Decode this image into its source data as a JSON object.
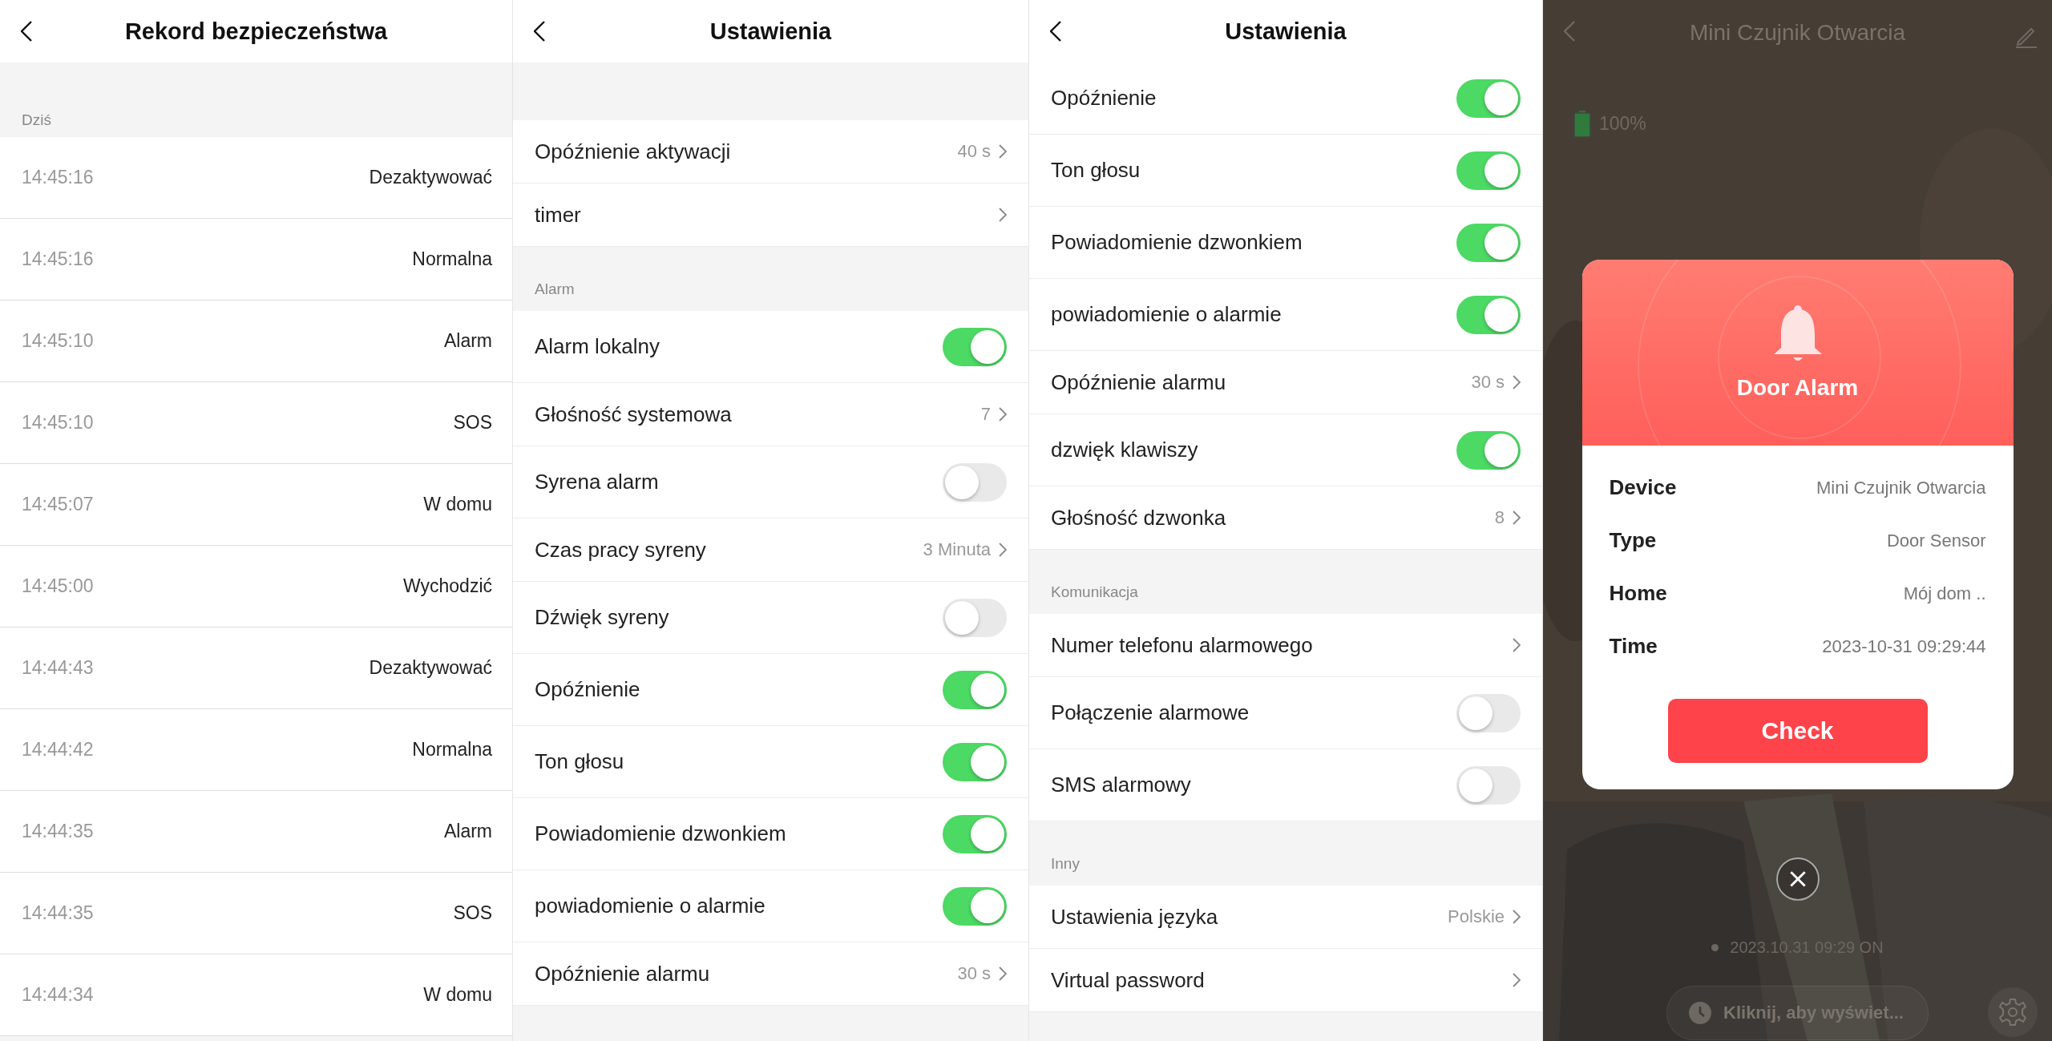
{
  "screens": [
    {
      "kind": "history",
      "title": "Rekord bezpieczeństwa",
      "section": "Dziś",
      "records": [
        {
          "time": "14:45:16",
          "event": "Dezaktywować"
        },
        {
          "time": "14:45:16",
          "event": "Normalna"
        },
        {
          "time": "14:45:10",
          "event": "Alarm"
        },
        {
          "time": "14:45:10",
          "event": "SOS"
        },
        {
          "time": "14:45:07",
          "event": "W domu"
        },
        {
          "time": "14:45:00",
          "event": "Wychodzić"
        },
        {
          "time": "14:44:43",
          "event": "Dezaktywować"
        },
        {
          "time": "14:44:42",
          "event": "Normalna"
        },
        {
          "time": "14:44:35",
          "event": "Alarm"
        },
        {
          "time": "14:44:35",
          "event": "SOS"
        },
        {
          "time": "14:44:34",
          "event": "W domu"
        }
      ]
    },
    {
      "kind": "settings",
      "title": "Ustawienia",
      "rows": [
        {
          "kind": "nav",
          "label": "Opóźnienie aktywacji",
          "value": "40 s"
        },
        {
          "kind": "nav",
          "label": "timer"
        },
        {
          "kind": "section",
          "label": "Alarm"
        },
        {
          "kind": "toggle",
          "label": "Alarm lokalny",
          "on": true
        },
        {
          "kind": "nav",
          "label": "Głośność systemowa",
          "value": "7"
        },
        {
          "kind": "toggle",
          "label": "Syrena alarm",
          "on": false
        },
        {
          "kind": "nav",
          "label": "Czas pracy syreny",
          "value": "3 Minuta"
        },
        {
          "kind": "toggle",
          "label": "Dźwięk syreny",
          "on": false
        },
        {
          "kind": "toggle",
          "label": "Opóźnienie",
          "on": true
        },
        {
          "kind": "toggle",
          "label": "Ton głosu",
          "on": true
        },
        {
          "kind": "toggle",
          "label": "Powiadomienie dzwonkiem",
          "on": true
        },
        {
          "kind": "toggle",
          "label": "powiadomienie o alarmie",
          "on": true
        },
        {
          "kind": "nav",
          "label": "Opóźnienie alarmu",
          "value": "30 s"
        }
      ]
    },
    {
      "kind": "settings",
      "title": "Ustawienia",
      "rows": [
        {
          "kind": "toggle",
          "label": "Opóźnienie",
          "on": true
        },
        {
          "kind": "toggle",
          "label": "Ton głosu",
          "on": true
        },
        {
          "kind": "toggle",
          "label": "Powiadomienie dzwonkiem",
          "on": true
        },
        {
          "kind": "toggle",
          "label": "powiadomienie o alarmie",
          "on": true
        },
        {
          "kind": "nav",
          "label": "Opóźnienie alarmu",
          "value": "30 s"
        },
        {
          "kind": "toggle",
          "label": "dzwięk klawiszy",
          "on": true
        },
        {
          "kind": "nav",
          "label": "Głośność dzwonka",
          "value": "8"
        },
        {
          "kind": "section",
          "label": "Komunikacja"
        },
        {
          "kind": "nav",
          "label": "Numer telefonu alarmowego"
        },
        {
          "kind": "toggle",
          "label": "Połączenie alarmowe",
          "on": false
        },
        {
          "kind": "toggle",
          "label": "SMS alarmowy",
          "on": false
        },
        {
          "kind": "section",
          "label": "Inny"
        },
        {
          "kind": "nav",
          "label": "Ustawienia języka",
          "value": "Polskie"
        },
        {
          "kind": "nav",
          "label": "Virtual password"
        }
      ]
    },
    {
      "kind": "device",
      "title": "Mini Czujnik Otwarcia",
      "battery": "100%",
      "alert": {
        "title": "Door Alarm",
        "fields": [
          {
            "label": "Device",
            "value": "Mini Czujnik Otwarcia"
          },
          {
            "label": "Type",
            "value": "Door Sensor"
          },
          {
            "label": "Home",
            "value": "Mój dom .."
          },
          {
            "label": "Time",
            "value": "2023-10-31 09:29:44"
          }
        ],
        "button": "Check"
      },
      "status": "2023.10.31 09:29 ON",
      "history_button": "Kliknij, aby wyświet..."
    }
  ]
}
